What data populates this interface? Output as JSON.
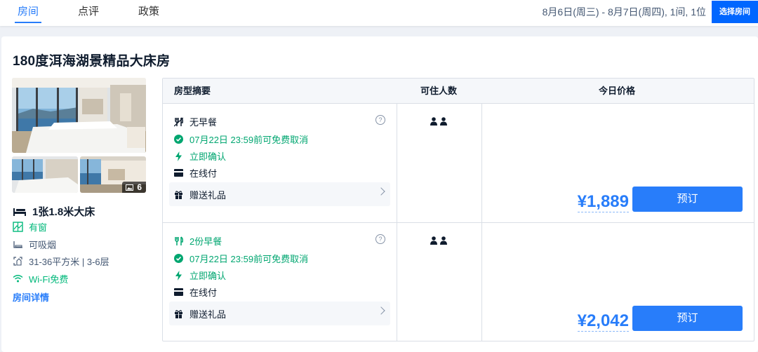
{
  "nav": {
    "tabs": [
      {
        "label": "房间",
        "active": true
      },
      {
        "label": "点评",
        "active": false
      },
      {
        "label": "政策",
        "active": false
      }
    ],
    "date_summary": "8月6日(周三) - 8月7日(周四), 1间, 1位",
    "select_room_label": "选择房间"
  },
  "room": {
    "title": "180度洱海湖景精品大床房",
    "photo_count": "6",
    "bed": "1张1.8米大床",
    "amenities": [
      {
        "icon": "window-icon",
        "text": "有窗"
      },
      {
        "icon": "smoking-icon",
        "text": "可吸烟"
      },
      {
        "icon": "area-icon",
        "text": "31-36平方米 | 3-6层"
      },
      {
        "icon": "wifi-icon",
        "text": "Wi-Fi免费"
      }
    ],
    "detail_link": "房间详情"
  },
  "table": {
    "headers": [
      "房型摘要",
      "可住人数",
      "今日价格"
    ],
    "rows": [
      {
        "meal": "无早餐",
        "cancel": "07月22日 23:59前可免费取消",
        "confirm": "立即确认",
        "payment": "在线付",
        "gift": "赠送礼品",
        "occupancy": 2,
        "price": "¥1,889",
        "book_label": "预订"
      },
      {
        "meal": "2份早餐",
        "cancel": "07月22日 23:59前可免费取消",
        "confirm": "立即确认",
        "payment": "在线付",
        "gift": "赠送礼品",
        "occupancy": 2,
        "price": "¥2,042",
        "book_label": "预订"
      }
    ]
  },
  "colors": {
    "accent": "#287dfa",
    "green": "#00a670",
    "button": "#0066ff"
  }
}
